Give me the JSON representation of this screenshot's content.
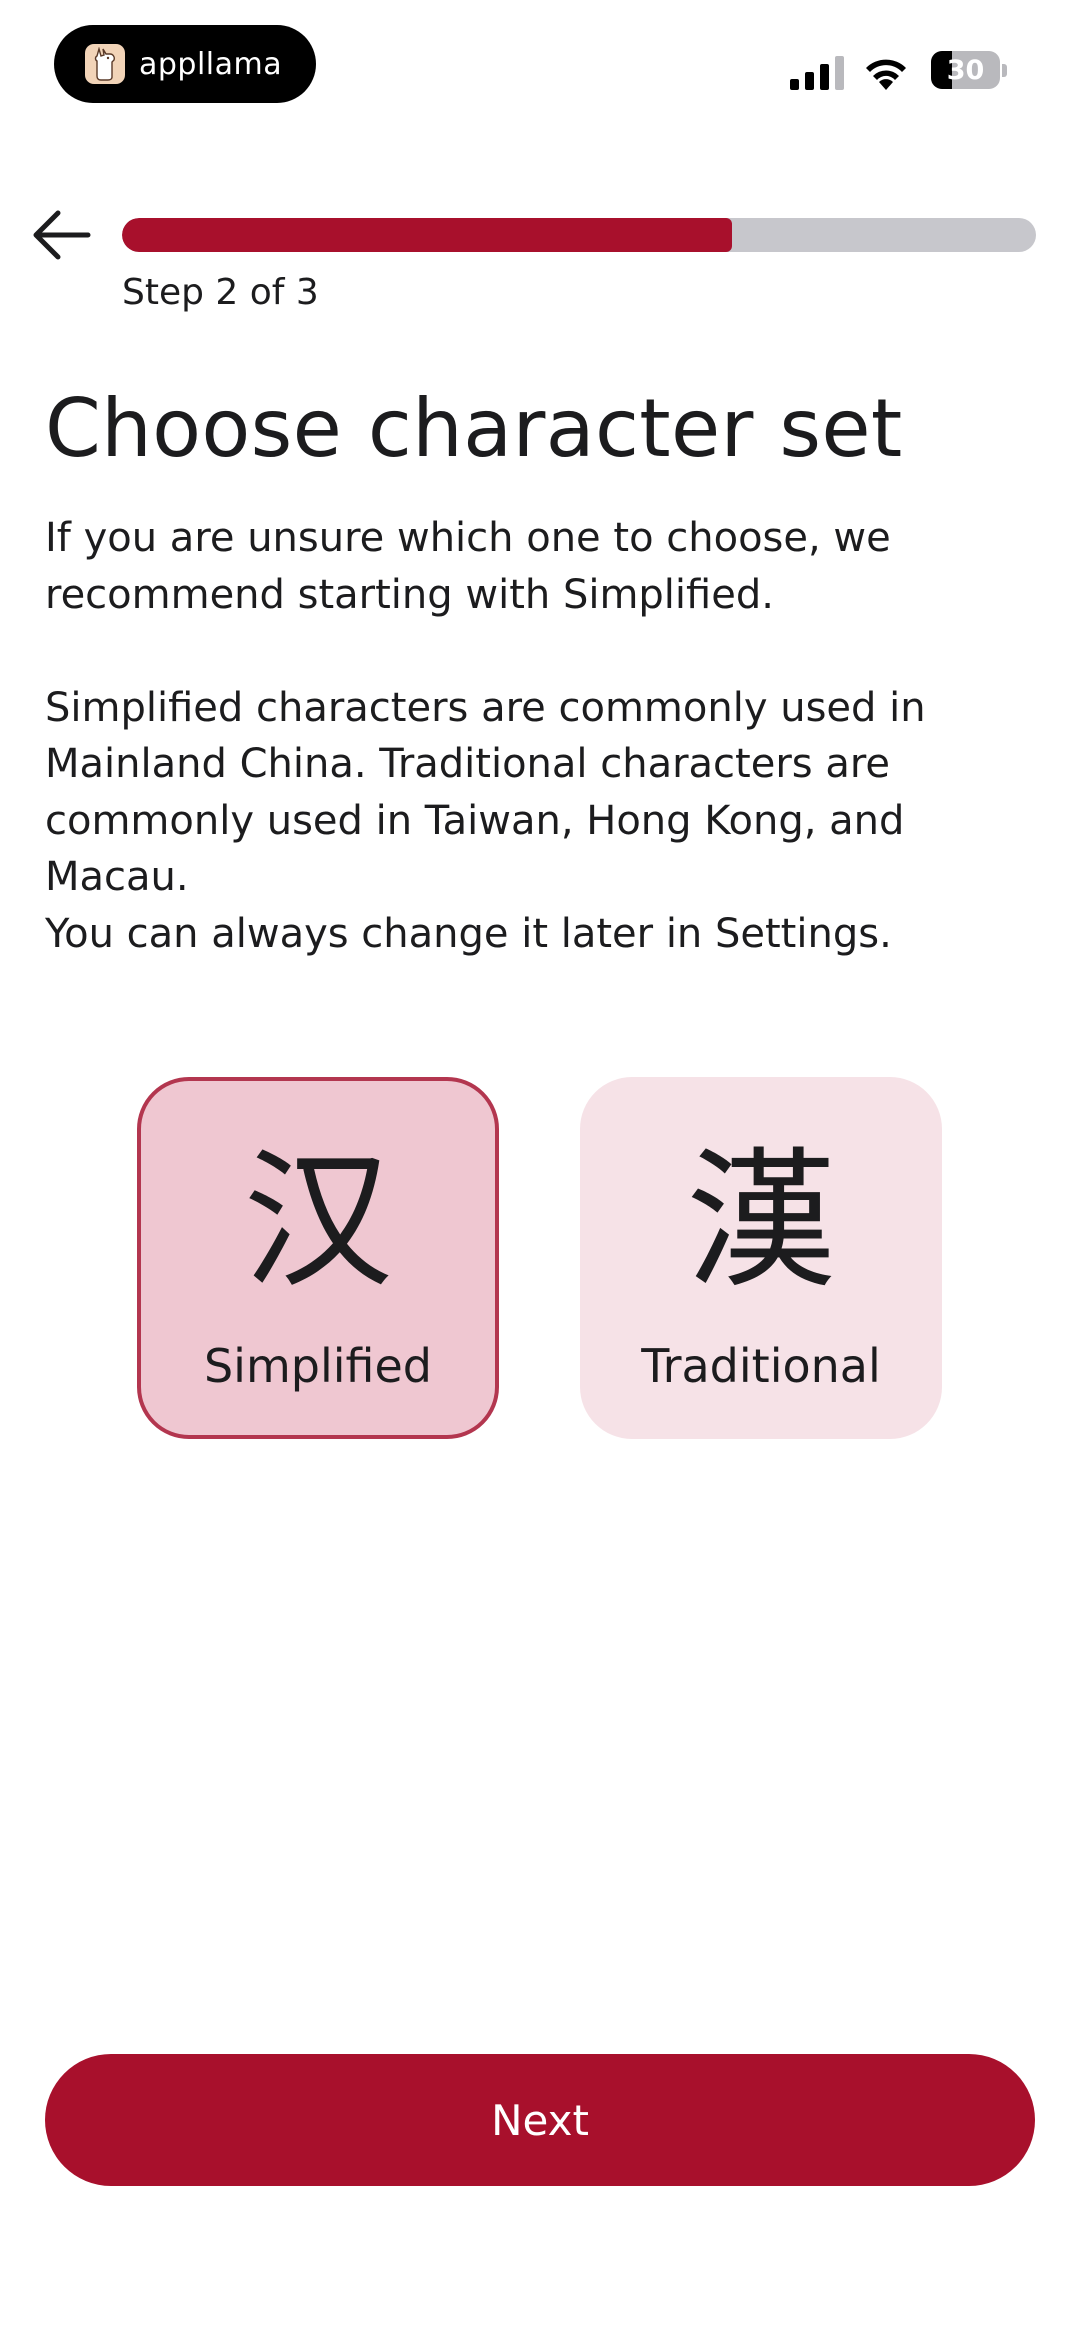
{
  "status_bar": {
    "app_name": "appllama",
    "app_icon": "llama-icon",
    "battery_percent": 30,
    "battery_text": "30",
    "signal_icon": "cellular-signal-icon",
    "wifi_icon": "wifi-icon"
  },
  "header": {
    "back_icon": "arrow-left-icon",
    "progress_fraction": 0.667,
    "step_label": "Step 2 of 3"
  },
  "main": {
    "title": "Choose character set",
    "description_line1": "If you are unsure which one to choose, we recommend starting with Simplified.",
    "description_line2": "Simplified characters are commonly used in Mainland China. Traditional characters are commonly used in Taiwan, Hong Kong, and Macau.",
    "description_line3": "You can always change it later in Settings.",
    "options": [
      {
        "glyph": "汉",
        "label": "Simplified",
        "selected": true
      },
      {
        "glyph": "漢",
        "label": "Traditional",
        "selected": false
      }
    ]
  },
  "footer": {
    "next_label": "Next"
  },
  "colors": {
    "accent": "#a8102c",
    "progress_track": "#c7c7cc",
    "selected_card_bg": "#efc7d1",
    "selected_card_border": "#b3364f",
    "unselected_card_bg": "#f6e2e7",
    "text": "#1c1c1e"
  }
}
